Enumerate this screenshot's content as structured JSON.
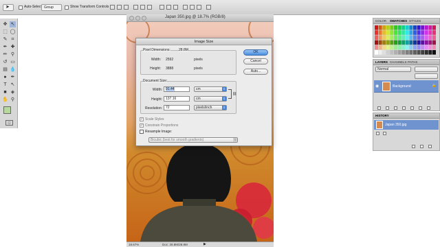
{
  "options_bar": {
    "auto_select_label": "Auto-Select:",
    "auto_select_value": "Group",
    "show_transform_label": "Show Transform Controls"
  },
  "document": {
    "title": "Japan 350.jpg @ 18.7% (RGB/8)",
    "zoom": "18.67%",
    "doc_info": "Doc: 28.8M/28.8M"
  },
  "dialog": {
    "title": "Image Size",
    "pixel_dimensions_label": "Pixel Dimensions:",
    "pixel_dimensions_value": "28.8M",
    "px_width_label": "Width:",
    "px_width_value": "2592",
    "px_width_unit": "pixels",
    "px_height_label": "Height:",
    "px_height_value": "3888",
    "px_height_unit": "pixels",
    "document_size_label": "Document Size:",
    "doc_width_label": "Width:",
    "doc_width_value": "91.44",
    "doc_width_unit": "cm",
    "doc_height_label": "Height:",
    "doc_height_value": "137.16",
    "doc_height_unit": "cm",
    "resolution_label": "Resolution:",
    "resolution_value": "72",
    "resolution_unit": "pixels/inch",
    "scale_styles_label": "Scale Styles",
    "constrain_label": "Constrain Proportions",
    "resample_label": "Resample Image:",
    "resample_method": "Bicubic (best for smooth gradients)",
    "ok_label": "OK",
    "cancel_label": "Cancel",
    "auto_label": "Auto..."
  },
  "panels": {
    "swatches_tabs": [
      "COLOR",
      "SWATCHES",
      "STYLES"
    ],
    "layers_tabs": [
      "LAYERS",
      "CHANNELS",
      "PATHS"
    ],
    "blend_mode": "Normal",
    "layer_name": "Background",
    "history_tab": "HISTORY",
    "history_item": "Japan 350.jpg"
  },
  "colors": {
    "accent_blue": "#4a86d8",
    "selection_blue": "#6f93cf",
    "foreground_swatch": "#b8d8a0",
    "background_swatch": "#ffffff"
  }
}
